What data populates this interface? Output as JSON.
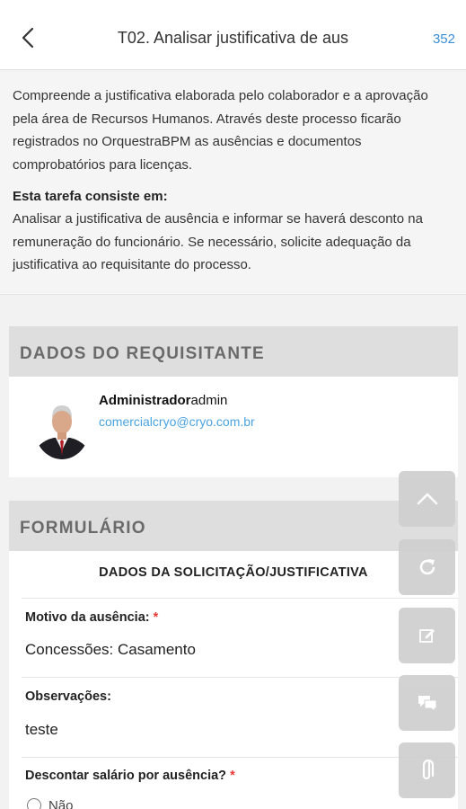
{
  "header": {
    "title": "T02. Analisar justificativa de aus",
    "count": "352"
  },
  "description": {
    "intro": "Compreende a justificativa elaborada pelo colaborador e a aprovação pela área de Recursos Humanos. Através deste processo ficarão registrados no OrquestraBPM as ausências e documentos comprobatórios para licenças.",
    "task_heading": "Esta tarefa consiste em:",
    "task_text": "Analisar a justificativa de ausência e informar se haverá desconto na remuneração do funcionário. Se necessário, solicite adequação da justificativa ao requisitante do processo."
  },
  "requester": {
    "section_title": "DADOS DO REQUISITANTE",
    "name": "Administrador",
    "username": "admin",
    "email": "comercialcryo@cryo.com.br"
  },
  "form": {
    "section_title": "FORMULÁRIO",
    "subtitle": "DADOS DA SOLICITAÇÃO/JUSTIFICATIVA",
    "fields": [
      {
        "label": "Motivo da ausência:",
        "required": "*",
        "value": "Concessões: Casamento"
      },
      {
        "label": "Observações:",
        "value": "teste"
      },
      {
        "label": "Descontar salário por ausência?",
        "required": "*",
        "option": "Não"
      }
    ]
  },
  "fab_icons": [
    "chevron-up-icon",
    "refresh-icon",
    "edit-icon",
    "chat-icon",
    "attachment-icon"
  ],
  "colors": {
    "link": "#3b8ed6",
    "required": "#e53935",
    "section_bg": "#dedede"
  }
}
